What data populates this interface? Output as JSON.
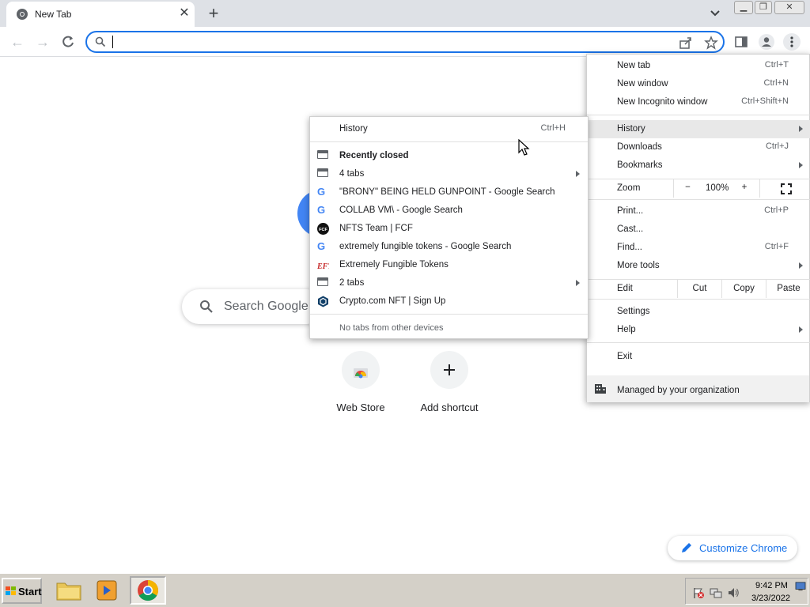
{
  "browser": {
    "tab": {
      "title": "New Tab"
    },
    "omnibox": {
      "value": "",
      "placeholder": ""
    }
  },
  "ntp": {
    "search_placeholder": "Search Google",
    "shortcuts": [
      {
        "label": "Web Store"
      },
      {
        "label": "Add shortcut"
      }
    ],
    "customize_label": "Customize Chrome"
  },
  "chrome_menu": {
    "new_tab": {
      "label": "New tab",
      "shortcut": "Ctrl+T"
    },
    "new_window": {
      "label": "New window",
      "shortcut": "Ctrl+N"
    },
    "new_incognito": {
      "label": "New Incognito window",
      "shortcut": "Ctrl+Shift+N"
    },
    "history": {
      "label": "History"
    },
    "downloads": {
      "label": "Downloads",
      "shortcut": "Ctrl+J"
    },
    "bookmarks": {
      "label": "Bookmarks"
    },
    "zoom": {
      "label": "Zoom",
      "minus": "−",
      "level": "100%",
      "plus": "+"
    },
    "print": {
      "label": "Print...",
      "shortcut": "Ctrl+P"
    },
    "cast": {
      "label": "Cast..."
    },
    "find": {
      "label": "Find...",
      "shortcut": "Ctrl+F"
    },
    "more_tools": {
      "label": "More tools"
    },
    "edit": {
      "label": "Edit",
      "cut": "Cut",
      "copy": "Copy",
      "paste": "Paste"
    },
    "settings": {
      "label": "Settings"
    },
    "help": {
      "label": "Help"
    },
    "exit": {
      "label": "Exit"
    },
    "managed": {
      "label": "Managed by your organization"
    }
  },
  "history_menu": {
    "history": {
      "label": "History",
      "shortcut": "Ctrl+H"
    },
    "recently_closed": "Recently closed",
    "items": [
      {
        "label": "4 tabs",
        "icon": "tabs-icon",
        "submenu": true
      },
      {
        "label": "\"BRONY\" BEING HELD GUNPOINT - Google Search",
        "icon": "google-icon"
      },
      {
        "label": "COLLAB VM\\ - Google Search",
        "icon": "google-icon"
      },
      {
        "label": "NFTS Team | FCF",
        "icon": "fcf-icon"
      },
      {
        "label": "extremely fungible tokens - Google Search",
        "icon": "google-icon"
      },
      {
        "label": "Extremely Fungible Tokens",
        "icon": "eft-icon"
      },
      {
        "label": "2 tabs",
        "icon": "tabs-icon",
        "submenu": true
      },
      {
        "label": "Crypto.com NFT | Sign Up",
        "icon": "crypto-icon"
      }
    ],
    "no_tabs": "No tabs from other devices"
  },
  "taskbar": {
    "start_label": "Start",
    "time": "9:42 PM",
    "date": "3/23/2022"
  },
  "colors": {
    "accent": "#1a73e8",
    "tabstrip": "#dee1e6",
    "taskbar": "#d4d0c8"
  }
}
